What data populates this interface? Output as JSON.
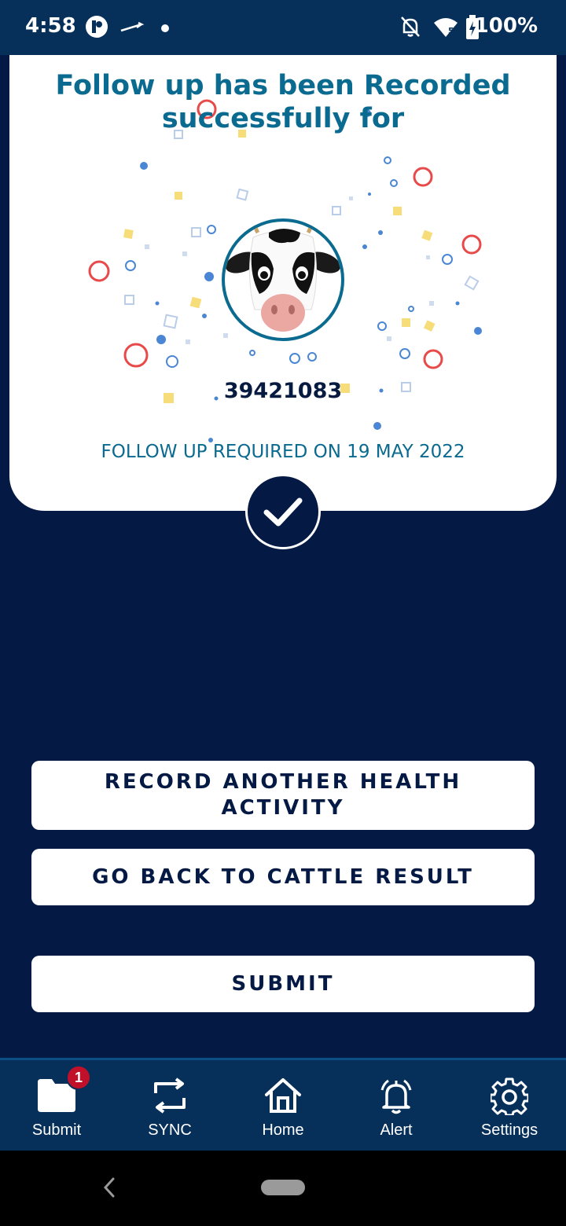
{
  "status_bar": {
    "time": "4:58",
    "battery": "100%",
    "icons": [
      "app-icon",
      "airplane-arrow-icon",
      "dot-icon",
      "notifications-off-icon",
      "wifi-5-icon",
      "battery-charging-icon"
    ]
  },
  "success_card": {
    "title": "Follow up has been Recorded successfully for",
    "animal_tag": "39421083",
    "followup_text": "FOLLOW UP REQUIRED ON 19 MAY 2022"
  },
  "actions": {
    "record_another": "RECORD ANOTHER HEALTH ACTIVITY",
    "go_back": "GO BACK TO CATTLE RESULT",
    "submit": "SUBMIT"
  },
  "bottom_nav": {
    "items": [
      {
        "label": "Submit",
        "icon": "folder-icon",
        "badge": "1"
      },
      {
        "label": "SYNC",
        "icon": "sync-icon"
      },
      {
        "label": "Home",
        "icon": "home-icon"
      },
      {
        "label": "Alert",
        "icon": "bell-icon"
      },
      {
        "label": "Settings",
        "icon": "gear-icon"
      }
    ]
  },
  "colors": {
    "background": "#041a44",
    "status_bar": "#06305a",
    "accent_teal": "#0a6a8f",
    "confetti_red": "#e84a4a",
    "confetti_blue": "#4a86d4",
    "confetti_yellow": "#f7dd7a"
  }
}
